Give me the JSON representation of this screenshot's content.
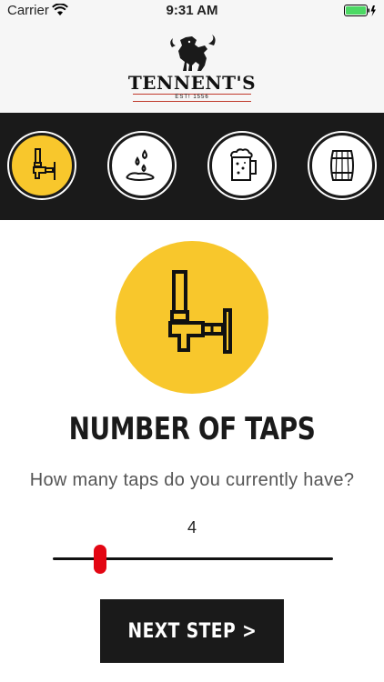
{
  "status_bar": {
    "carrier": "Carrier",
    "time": "9:31 AM"
  },
  "header": {
    "brand": "TENNENT'S",
    "tagline": "EST! 1556"
  },
  "steps": [
    {
      "icon": "tap-icon",
      "active": true
    },
    {
      "icon": "water-drops-icon",
      "active": false
    },
    {
      "icon": "beer-mug-icon",
      "active": false
    },
    {
      "icon": "barrel-icon",
      "active": false
    }
  ],
  "main": {
    "icon": "tap-icon",
    "title": "NUMBER OF TAPS",
    "question": "How many taps do you currently have?",
    "slider_value": "4",
    "next_label": "NEXT STEP >"
  },
  "colors": {
    "accent_yellow": "#f8c72c",
    "dark": "#1a1a1a",
    "slider_thumb": "#e30613",
    "battery_green": "#4cd964"
  }
}
